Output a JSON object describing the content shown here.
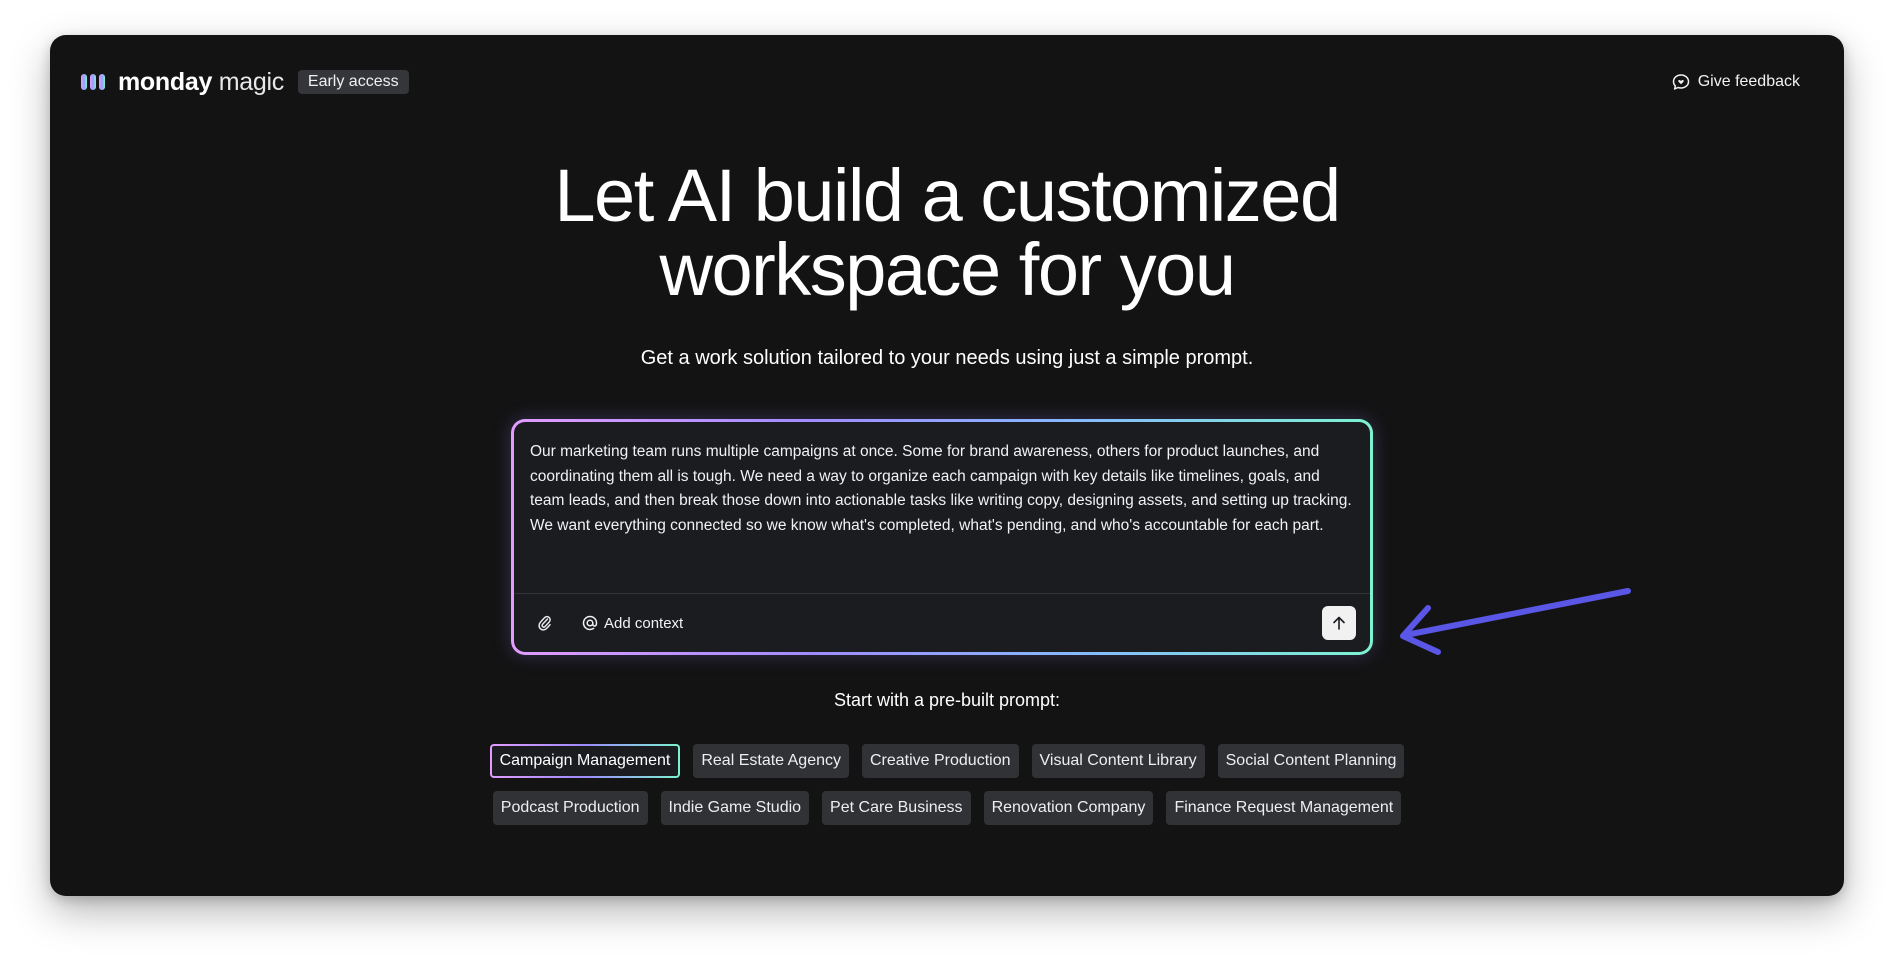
{
  "header": {
    "brand_bold": "monday",
    "brand_light": " magic",
    "badge": "Early access",
    "feedback_label": "Give feedback",
    "logo_icon": "monday-logo-icon",
    "feedback_icon": "chat-heart-icon"
  },
  "hero": {
    "headline_line1": "Let AI build a customized",
    "headline_line2": "workspace for you",
    "subtitle": "Get a work solution tailored to your needs using just a simple prompt."
  },
  "prompt": {
    "text": "Our marketing team runs multiple campaigns at once. Some for brand awareness, others for product launches, and coordinating them all is tough. We need a way to organize each campaign with key details like timelines, goals, and team leads, and then break those down into actionable tasks like writing copy, designing assets, and setting up tracking. We want everything connected so we know what's completed, what's pending, and who's accountable for each part.",
    "attach_icon": "paperclip-icon",
    "add_context_icon": "at-sign-icon",
    "add_context_label": "Add context",
    "send_icon": "arrow-up-icon"
  },
  "prebuilt": {
    "title": "Start with a pre-built prompt:",
    "row1": [
      "Campaign Management",
      "Real Estate Agency",
      "Creative Production",
      "Visual Content Library",
      "Social Content Planning"
    ],
    "row2": [
      "Podcast Production",
      "Indie Game Studio",
      "Pet Care Business",
      "Renovation Company",
      "Finance Request Management"
    ],
    "selected": "Campaign Management"
  },
  "colors": {
    "background": "#131314",
    "accent_gradient": [
      "#e29cff",
      "#a08cff",
      "#86b8ff",
      "#7cf3d0"
    ],
    "annotation_arrow": "#5a57e6"
  }
}
